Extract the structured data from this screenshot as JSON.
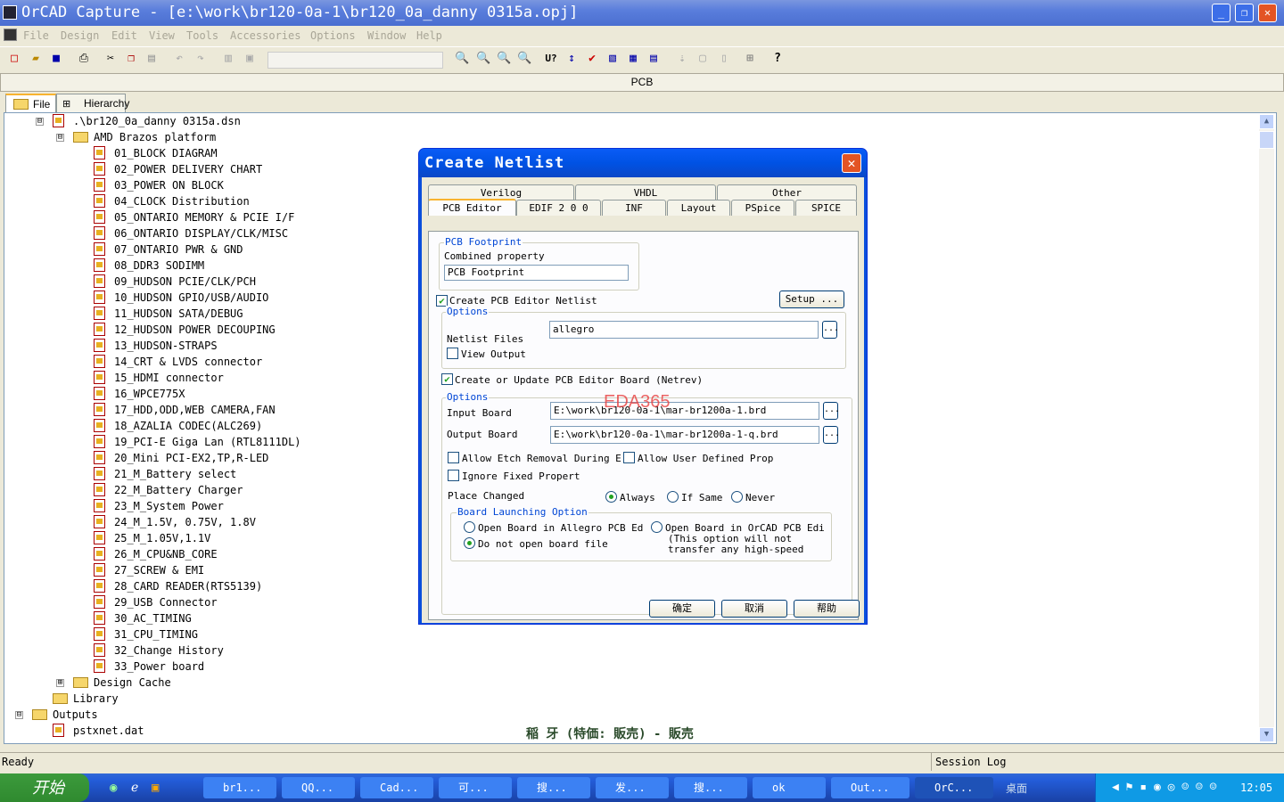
{
  "window": {
    "title": "OrCAD Capture - [e:\\work\\br120-0a-1\\br120_0a_danny 0315a.opj]",
    "min": "_",
    "max": "❐",
    "close": "✕"
  },
  "menu": [
    "File",
    "Design",
    "Edit",
    "View",
    "Tools",
    "Accessories",
    "Options",
    "Window",
    "Help"
  ],
  "pcb_bar": "PCB",
  "panel_tabs": [
    "File",
    "Hierarchy"
  ],
  "tree": {
    "root": ".\\br120_0a_danny 0315a.dsn",
    "folder": "AMD Brazos platform",
    "pages": [
      "01_BLOCK DIAGRAM",
      "02_POWER DELIVERY CHART",
      "03_POWER ON BLOCK",
      "04_CLOCK Distribution",
      "05_ONTARIO MEMORY & PCIE I/F",
      "06_ONTARIO DISPLAY/CLK/MISC",
      "07_ONTARIO PWR & GND",
      "08_DDR3 SODIMM",
      "09_HUDSON PCIE/CLK/PCH",
      "10_HUDSON GPIO/USB/AUDIO",
      "11_HUDSON SATA/DEBUG",
      "12_HUDSON POWER DECOUPING",
      "13_HUDSON-STRAPS",
      "14_CRT & LVDS connector",
      "15_HDMI connector",
      "16_WPCE775X",
      "17_HDD,ODD,WEB CAMERA,FAN",
      "18_AZALIA CODEC(ALC269)",
      "19_PCI-E Giga Lan (RTL8111DL)",
      "20_Mini PCI-EX2,TP,R-LED",
      "21_M_Battery select",
      "22_M_Battery Charger",
      "23_M_System Power",
      "24_M_1.5V, 0.75V, 1.8V",
      "25_M_1.05V,1.1V",
      "26_M_CPU&NB_CORE",
      "27_SCREW & EMI",
      "28_CARD READER(RTS5139)",
      "29_USB Connector",
      "30_AC_TIMING",
      "31_CPU_TIMING",
      "32_Change History",
      "33_Power board"
    ],
    "design_cache": "Design Cache",
    "library": "Library",
    "outputs": "Outputs",
    "output_file": "pstxnet.dat"
  },
  "overlay_text": "稲 牙 (特価: 販売) - 販売",
  "status": {
    "left": "Ready",
    "right": "Session Log"
  },
  "dialog": {
    "title": "Create Netlist",
    "tabs_back": [
      "Verilog",
      "VHDL",
      "Other"
    ],
    "tabs_front": [
      "PCB Editor",
      "EDIF 2 0 0",
      "INF",
      "Layout",
      "PSpice",
      "SPICE"
    ],
    "footprint_group": "PCB Footprint",
    "combined_label": "Combined property",
    "combined_value": "PCB Footprint",
    "create_netlist": "Create PCB Editor Netlist",
    "setup": "Setup ...",
    "options1": "Options",
    "netlist_files_label": "Netlist Files",
    "netlist_files_value": "allegro",
    "view_output": "View Output",
    "create_board": "Create or Update PCB Editor Board (Netrev)",
    "options2": "Options",
    "input_board_label": "Input Board",
    "input_board_value": "E:\\work\\br120-0a-1\\mar-br1200a-1.brd",
    "output_board_label": "Output Board",
    "output_board_value": "E:\\work\\br120-0a-1\\mar-br1200a-1-q.brd",
    "allow_etch": "Allow Etch Removal During E",
    "allow_user": "Allow User Defined Prop",
    "ignore_fixed": "Ignore Fixed Propert",
    "place_changed": "Place Changed",
    "place_options": [
      "Always",
      "If Same",
      "Never"
    ],
    "launch_group": "Board Launching Option",
    "launch_allegro": "Open Board in Allegro PCB Ed",
    "launch_none": "Do not open board file",
    "launch_orcad": "Open Board in OrCAD PCB Edi",
    "launch_note1": "(This option will not",
    "launch_note2": "transfer any high-speed",
    "ok": "确定",
    "cancel": "取消",
    "help": "帮助",
    "watermark": "EDA365"
  },
  "taskbar": {
    "start": "开始",
    "tasks": [
      "br1...",
      "QQ...",
      "Cad...",
      "可...",
      "搜...",
      "发...",
      "搜...",
      "ok",
      "Out...",
      "OrC..."
    ],
    "desktop": "桌面",
    "clock": "12:05"
  }
}
